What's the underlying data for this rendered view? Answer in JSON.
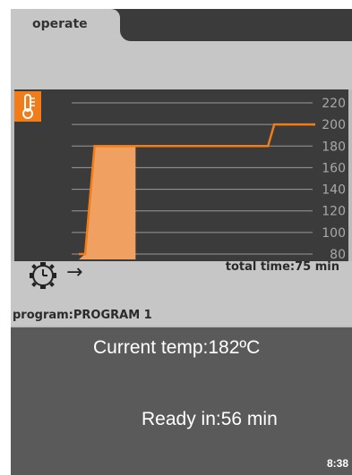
{
  "tabs": {
    "active_label": "operate"
  },
  "chart_data": {
    "type": "line",
    "y_ticks": [
      80,
      100,
      120,
      140,
      160,
      180,
      200,
      220
    ],
    "ylim": [
      75,
      225
    ],
    "x": [
      0,
      2,
      5,
      14,
      60,
      62,
      75
    ],
    "y": [
      80,
      80,
      180,
      180,
      180,
      200,
      200
    ],
    "xlim": [
      0,
      75
    ],
    "fill_region": {
      "x_start": 0,
      "x_end": 18
    },
    "colors": {
      "line": "#f07c1a",
      "fill": "#f0a060",
      "background": "#3b3b3b",
      "grid": "#9a9a9a",
      "tick_text": "#a8a8a8"
    }
  },
  "chart_icon": "thermometer-icon",
  "schedule_icon": "clock-gear-icon",
  "arrow_glyph": "→",
  "total_time": "total time:75 min",
  "program": "program:PROGRAM 1",
  "current_temp": "Current temp:182ºC",
  "ready_in": "Ready in:56 min",
  "clock": "8:38"
}
